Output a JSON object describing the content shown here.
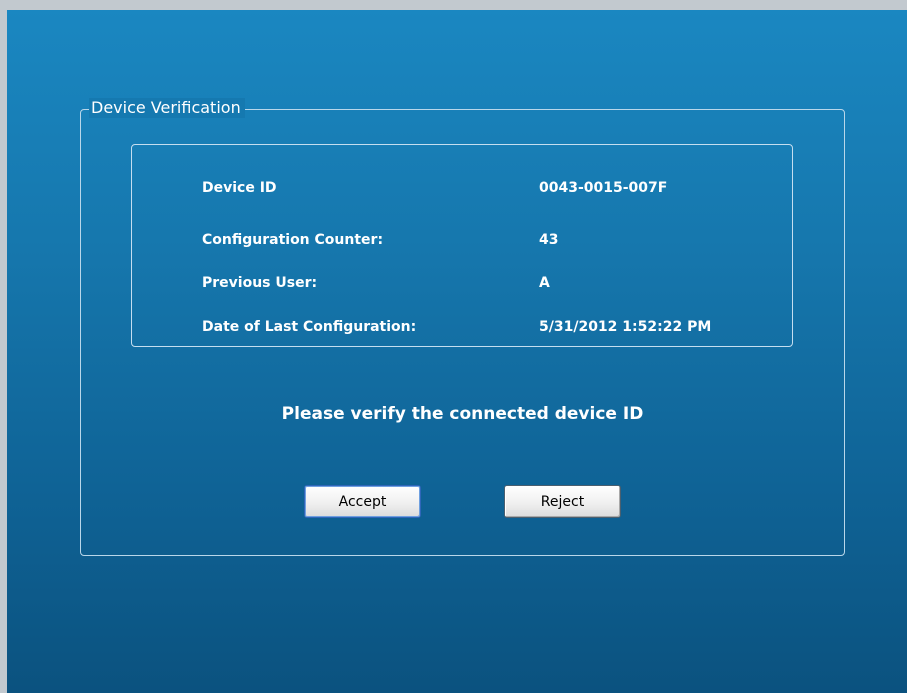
{
  "dialog": {
    "group_title": "Device Verification",
    "info": [
      {
        "label": "Device ID",
        "value": "0043-0015-007F"
      },
      {
        "label": "Configuration Counter:",
        "value": "43"
      },
      {
        "label": "Previous User:",
        "value": "A"
      },
      {
        "label": "Date of Last Configuration:",
        "value": "5/31/2012 1:52:22 PM"
      }
    ],
    "prompt": "Please verify the connected device ID",
    "accept_label": "Accept",
    "reject_label": "Reject"
  },
  "colors": {
    "background_top": "#1a87c1",
    "background_bottom": "#0b527f",
    "border": "#b9d7ea",
    "text": "#ffffff"
  }
}
